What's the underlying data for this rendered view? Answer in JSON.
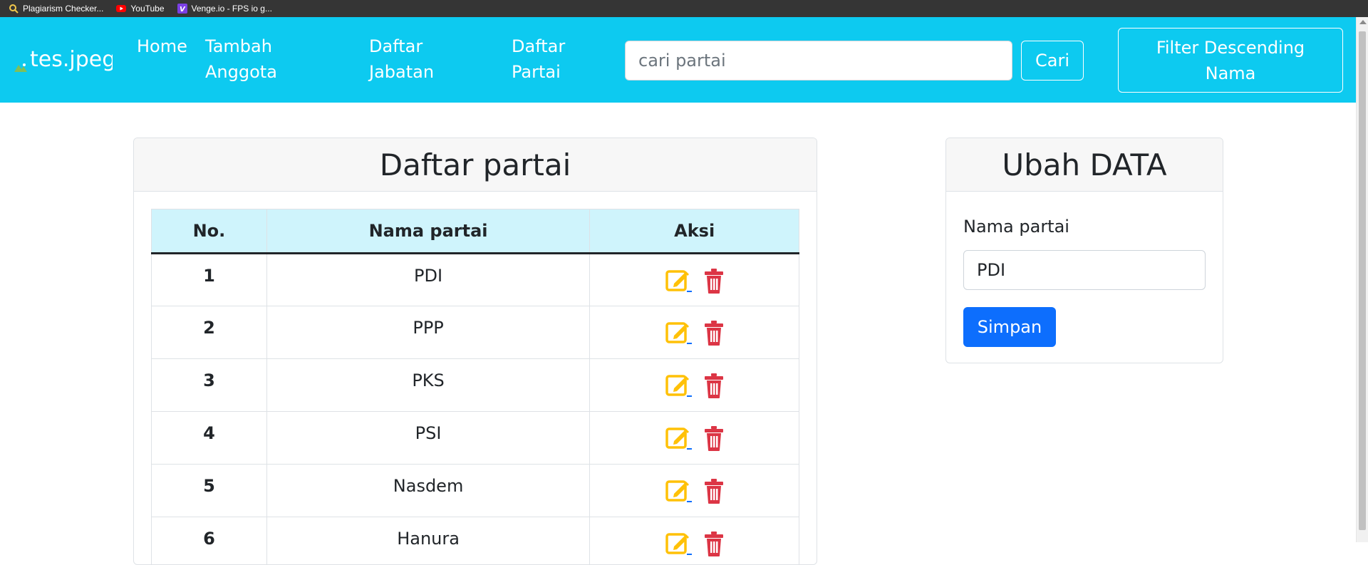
{
  "bookmarks": [
    {
      "label": "Plagiarism Checker...",
      "icon": "magnifier-icon"
    },
    {
      "label": "YouTube",
      "icon": "youtube-icon"
    },
    {
      "label": "Venge.io - FPS io g...",
      "icon": "venge-icon"
    }
  ],
  "navbar": {
    "brand": "tes.jpeg",
    "links": [
      "Home",
      "Tambah Anggota",
      "Daftar Jabatan",
      "Daftar Partai"
    ],
    "search_placeholder": "cari partai",
    "search_button": "Cari",
    "filter_button": "Filter Descending Nama"
  },
  "list_card": {
    "title": "Daftar partai",
    "columns": [
      "No.",
      "Nama partai",
      "Aksi"
    ],
    "rows": [
      {
        "no": "1",
        "name": "PDI"
      },
      {
        "no": "2",
        "name": "PPP"
      },
      {
        "no": "3",
        "name": "PKS"
      },
      {
        "no": "4",
        "name": "PSI"
      },
      {
        "no": "5",
        "name": "Nasdem"
      },
      {
        "no": "6",
        "name": "Hanura"
      }
    ]
  },
  "edit_card": {
    "title": "Ubah DATA",
    "label": "Nama partai",
    "value": "PDI",
    "submit": "Simpan"
  },
  "colors": {
    "navbar": "#0dcaf0",
    "edit_icon": "#ffc107",
    "delete_icon": "#dc3545",
    "primary": "#0d6efd",
    "table_header": "#cff4fc"
  }
}
